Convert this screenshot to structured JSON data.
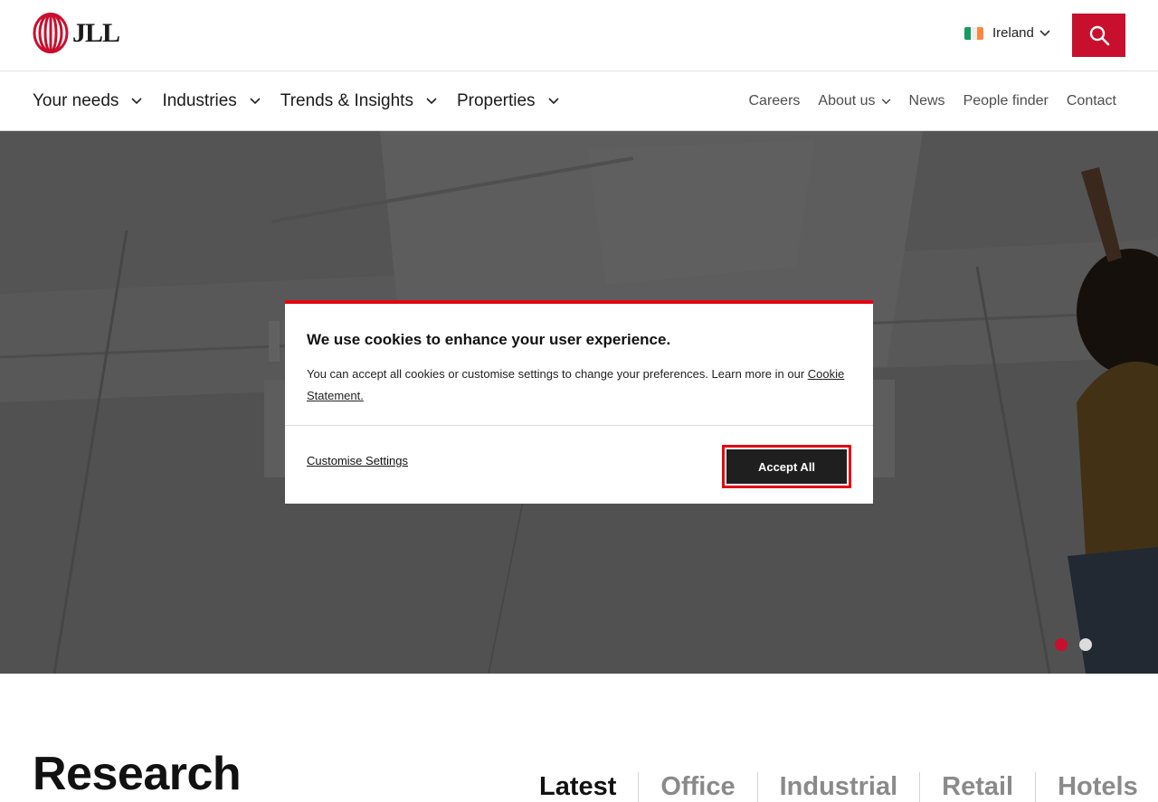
{
  "header": {
    "logo_text": "JLL",
    "country_label": "Ireland",
    "flag_colors": [
      "#169b62",
      "#ffffff",
      "#ff883e"
    ],
    "search_icon": "search-icon",
    "accent": "#c8102e"
  },
  "nav": {
    "main_items": [
      {
        "label": "Your needs"
      },
      {
        "label": "Industries"
      },
      {
        "label": "Trends & Insights"
      },
      {
        "label": "Properties"
      }
    ],
    "right_items": [
      {
        "label": "Careers"
      },
      {
        "label": "About us"
      },
      {
        "label": "News"
      },
      {
        "label": "People finder"
      },
      {
        "label": "Contact"
      }
    ]
  },
  "hero": {
    "carousel_active_color": "#c8102e",
    "carousel_inactive_color": "#dcdcdc"
  },
  "cookie": {
    "title": "We use cookies to enhance your user experience.",
    "body": "You can accept all cookies or customise settings to change your preferences. Learn more in our ",
    "link_label": "Cookie Statement.",
    "customise_label": "Customise Settings",
    "accept_label": "Accept All"
  },
  "research": {
    "heading": "Research",
    "tabs": [
      {
        "label": "Latest"
      },
      {
        "label": "Office"
      },
      {
        "label": "Industrial"
      },
      {
        "label": "Retail"
      },
      {
        "label": "Hotels"
      }
    ]
  }
}
